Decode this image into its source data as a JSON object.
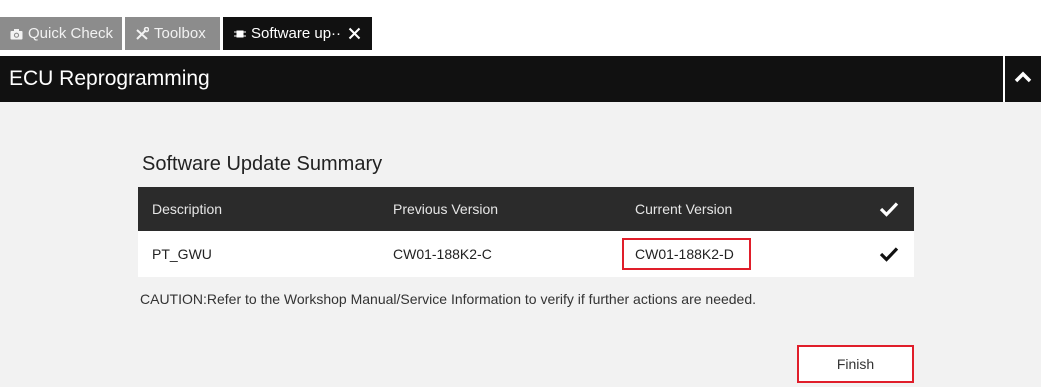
{
  "tabs": [
    {
      "label": "Quick Check",
      "icon": "camera-icon",
      "active": false
    },
    {
      "label": "Toolbox",
      "icon": "tools-icon",
      "active": false
    },
    {
      "label": "Software up··",
      "icon": "chip-icon",
      "active": true
    }
  ],
  "header": {
    "title": "ECU Reprogramming"
  },
  "summary": {
    "title": "Software Update Summary",
    "columns": [
      "Description",
      "Previous Version",
      "Current Version"
    ],
    "rows": [
      {
        "description": "PT_GWU",
        "previous_version": "CW01-188K2-C",
        "current_version": "CW01-188K2-D",
        "status": "check-icon"
      }
    ]
  },
  "caution": "CAUTION:Refer to the Workshop Manual/Service Information to verify if further actions are needed.",
  "finish_label": "Finish",
  "colors": {
    "header_bg": "#111111",
    "tab_inactive_bg": "#8c8c8c",
    "table_head_bg": "#2b2b2b",
    "highlight_red": "#e01e2a",
    "content_bg": "#f2f2f2"
  }
}
